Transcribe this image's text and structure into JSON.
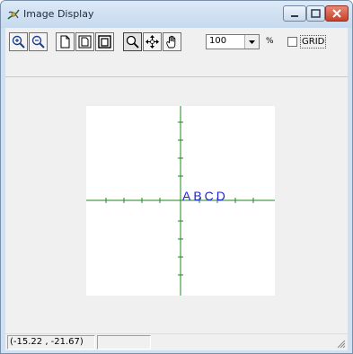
{
  "window": {
    "title": "Image Display"
  },
  "toolbar": {
    "zoom_in_icon": "zoom-in-icon",
    "zoom_out_icon": "zoom-out-icon",
    "zoom_percent": "100",
    "percent_symbol": "%",
    "grid_label": "GRID",
    "grid_checked": false
  },
  "canvas": {
    "text": "ABCD",
    "text_color": "#2222dd",
    "axis_color": "#1f8a1f"
  },
  "statusbar": {
    "coordinates": "(-15.22 , -21.67)"
  }
}
